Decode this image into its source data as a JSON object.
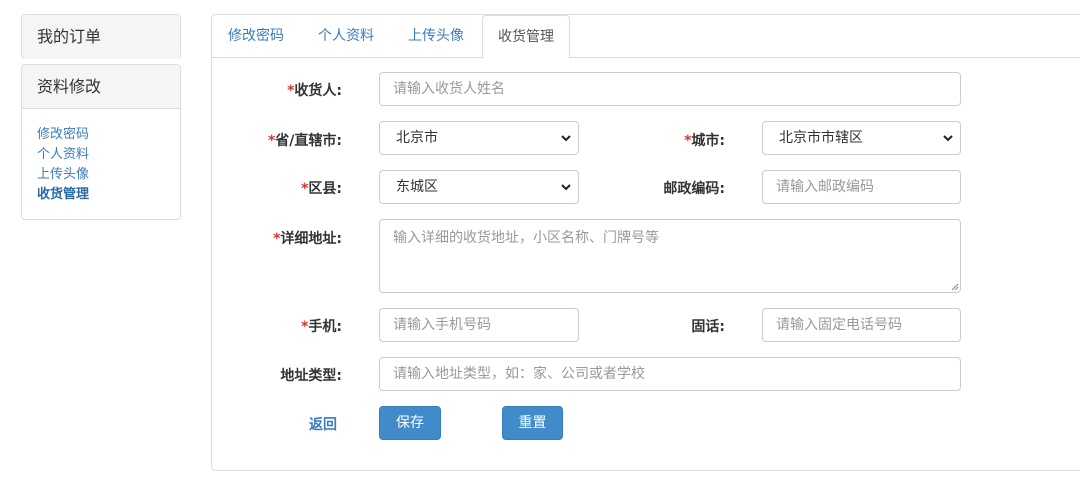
{
  "sidebar": {
    "orders_title": "我的订单",
    "profile_title": "资料修改",
    "links": [
      {
        "label": "修改密码"
      },
      {
        "label": "个人资料"
      },
      {
        "label": "上传头像"
      },
      {
        "label": "收货管理",
        "active": true
      }
    ]
  },
  "tabs": [
    {
      "label": "修改密码"
    },
    {
      "label": "个人资料"
    },
    {
      "label": "上传头像"
    },
    {
      "label": "收货管理",
      "active": true
    }
  ],
  "form": {
    "required_mark": "*",
    "receiver": {
      "label": "收货人:",
      "placeholder": "请输入收货人姓名"
    },
    "province": {
      "label": "省/直辖市:",
      "selected": "北京市"
    },
    "city": {
      "label": "城市:",
      "selected": "北京市市辖区"
    },
    "district": {
      "label": "区县:",
      "selected": "东城区"
    },
    "postcode": {
      "label": "邮政编码:",
      "placeholder": "请输入邮政编码"
    },
    "address": {
      "label": "详细地址:",
      "placeholder": "输入详细的收货地址，小区名称、门牌号等"
    },
    "mobile": {
      "label": "手机:",
      "placeholder": "请输入手机号码"
    },
    "phone": {
      "label": "固话:",
      "placeholder": "请输入固定电话号码"
    },
    "address_type": {
      "label": "地址类型:",
      "placeholder": "请输入地址类型，如：家、公司或者学校"
    }
  },
  "actions": {
    "back_label": "返回",
    "save_label": "保存",
    "reset_label": "重置"
  },
  "colors": {
    "accent": "#428bca",
    "link": "#3a7bbf",
    "required": "#d9342b"
  }
}
